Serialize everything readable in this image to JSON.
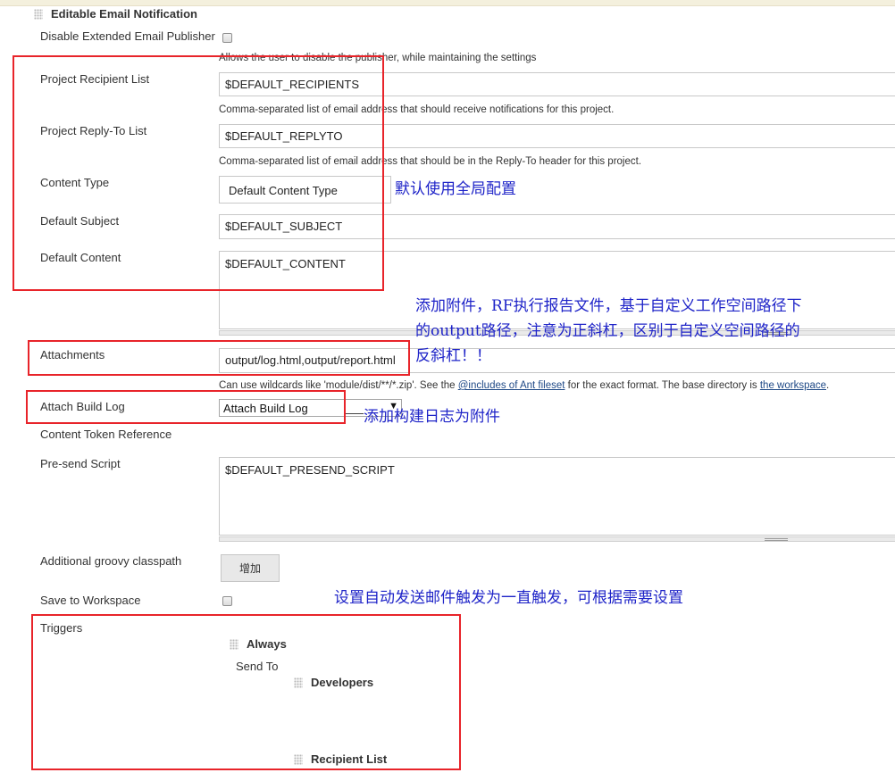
{
  "section": {
    "title": "Editable Email Notification"
  },
  "disable_publisher": {
    "label": "Disable Extended Email Publisher",
    "help": "Allows the user to disable the publisher, while maintaining the settings"
  },
  "recipient_list": {
    "label": "Project Recipient List",
    "value": "$DEFAULT_RECIPIENTS",
    "help": "Comma-separated list of email address that should receive notifications for this project."
  },
  "reply_to": {
    "label": "Project Reply-To List",
    "value": "$DEFAULT_REPLYTO",
    "help": "Comma-separated list of email address that should be in the Reply-To header for this project."
  },
  "content_type": {
    "label": "Content Type",
    "value": "Default Content Type"
  },
  "default_subject": {
    "label": "Default Subject",
    "value": "$DEFAULT_SUBJECT"
  },
  "default_content": {
    "label": "Default Content",
    "value": "$DEFAULT_CONTENT"
  },
  "attachments": {
    "label": "Attachments",
    "value": "output/log.html,output/report.html",
    "help_prefix": "Can use wildcards like 'module/dist/**/*.zip'. See the ",
    "help_link1": "@includes of Ant fileset",
    "help_middle": " for the exact format. The base directory is ",
    "help_link2": "the workspace",
    "help_suffix": "."
  },
  "attach_build_log": {
    "label": "Attach Build Log",
    "value": "Attach Build Log",
    "arrow": "▼"
  },
  "content_token": {
    "label": "Content Token Reference"
  },
  "presend_script": {
    "label": "Pre-send Script",
    "value": "$DEFAULT_PRESEND_SCRIPT"
  },
  "groovy_classpath": {
    "label": "Additional groovy classpath",
    "button": "增加"
  },
  "save_workspace": {
    "label": "Save to Workspace"
  },
  "triggers": {
    "label": "Triggers",
    "always": "Always",
    "send_to": "Send To",
    "developers": "Developers",
    "recipient_list": "Recipient List"
  },
  "annotations": {
    "global_config": "默认使用全局配置",
    "attachments_line1": "添加附件，RF执行报告文件，基于自定义工作空间路径下",
    "attachments_line2": "的output路径，注意为正斜杠，区别于自定义空间路径的",
    "attachments_line3": "反斜杠！！",
    "build_log": "添加构建日志为附件",
    "trigger": "设置自动发送邮件触发为一直触发，可根据需要设置"
  },
  "colors": {
    "annotation_box": "#e8242a",
    "annotation_text": "#1f24c8",
    "link": "#204a87"
  }
}
